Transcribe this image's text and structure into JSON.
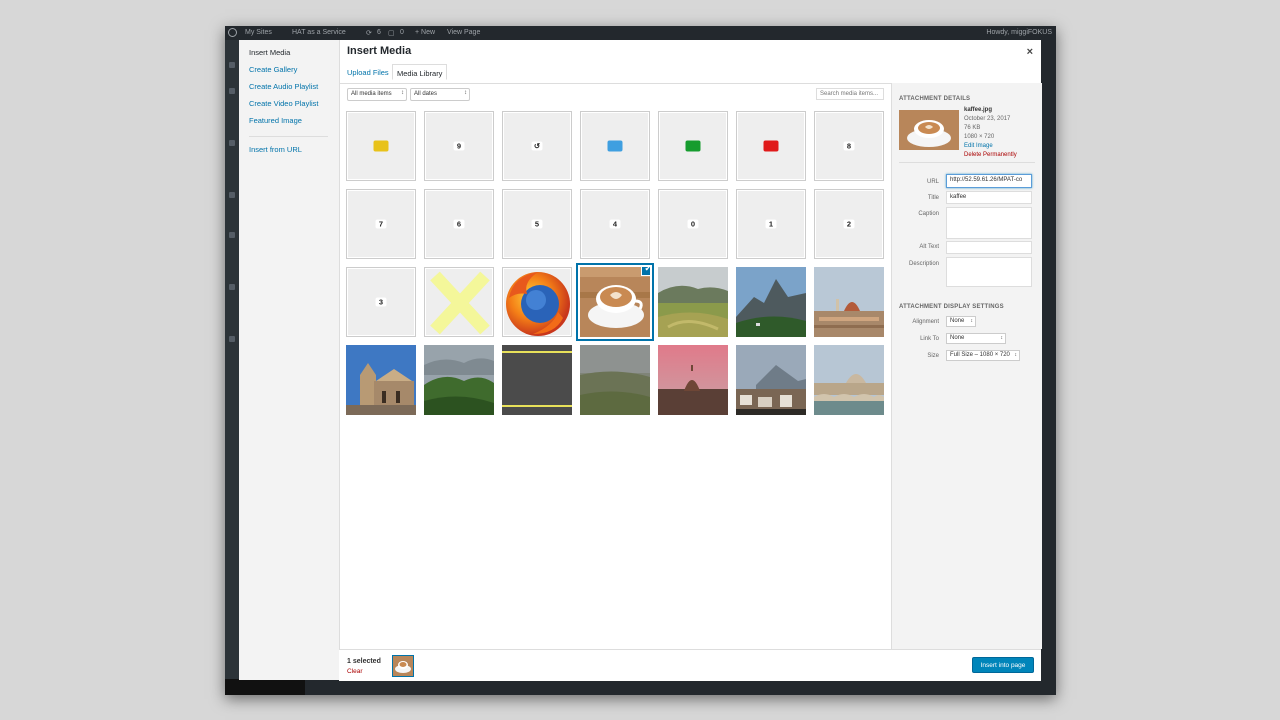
{
  "adminbar": {
    "my_sites": "My Sites",
    "site_name": "HAT as a Service",
    "updates_count": "6",
    "comments_count": "0",
    "new_label": "+ New",
    "view_page": "View Page",
    "howdy": "Howdy, miggiFOKUS"
  },
  "menu": {
    "items": [
      {
        "label": "Insert Media"
      },
      {
        "label": "Create Gallery"
      },
      {
        "label": "Create Audio Playlist"
      },
      {
        "label": "Create Video Playlist"
      },
      {
        "label": "Featured Image"
      },
      {
        "label": "Insert from URL"
      }
    ]
  },
  "header": {
    "title": "Insert Media",
    "close_icon": "×"
  },
  "tabs": {
    "upload": "Upload Files",
    "library": "Media Library"
  },
  "filters": {
    "type": "All media items",
    "date": "All dates",
    "search_placeholder": "Search media items..."
  },
  "grid": {
    "numbers": [
      "9",
      "8",
      "7",
      "6",
      "5",
      "4",
      "0",
      "1",
      "2",
      "3"
    ],
    "refresh_icon": "↺",
    "check_icon": "✔",
    "colors": {
      "yellow": "#e8c21a",
      "blue": "#3f9fe0",
      "green": "#169c2e",
      "red": "#e01a1a",
      "cross": "#f4f79a"
    }
  },
  "details": {
    "heading": "Attachment Details",
    "filename": "kaffee.jpg",
    "date": "October 23, 2017",
    "size": "76 KB",
    "dimensions": "1080 × 720",
    "edit_link": "Edit Image",
    "delete_link": "Delete Permanently",
    "fields": {
      "url_label": "URL",
      "url_value": "http://52.59.61.26/MPAT-co",
      "title_label": "Title",
      "title_value": "kaffee",
      "caption_label": "Caption",
      "alt_label": "Alt Text",
      "description_label": "Description"
    }
  },
  "display": {
    "heading": "Attachment Display Settings",
    "alignment_label": "Alignment",
    "alignment_value": "None",
    "link_label": "Link To",
    "link_value": "None",
    "size_label": "Size",
    "size_value": "Full Size – 1080 × 720"
  },
  "footer": {
    "selected": "1 selected",
    "clear": "Clear",
    "insert_button": "Insert into page"
  }
}
